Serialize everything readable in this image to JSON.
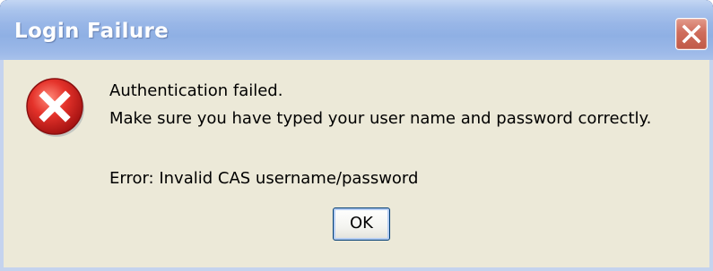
{
  "window": {
    "title": "Login Failure",
    "close_icon": "close-icon"
  },
  "message": {
    "icon": "error-icon",
    "line1": "Authentication failed.",
    "line2": "Make sure you have typed your user name and password correctly.",
    "error": "Error: Invalid CAS username/password"
  },
  "buttons": {
    "ok_label": "OK"
  },
  "colors": {
    "title_bar": "#98b6e7",
    "dialog_body": "#ece9d8",
    "close_button": "#c05a47",
    "error_icon": "#d42020"
  }
}
